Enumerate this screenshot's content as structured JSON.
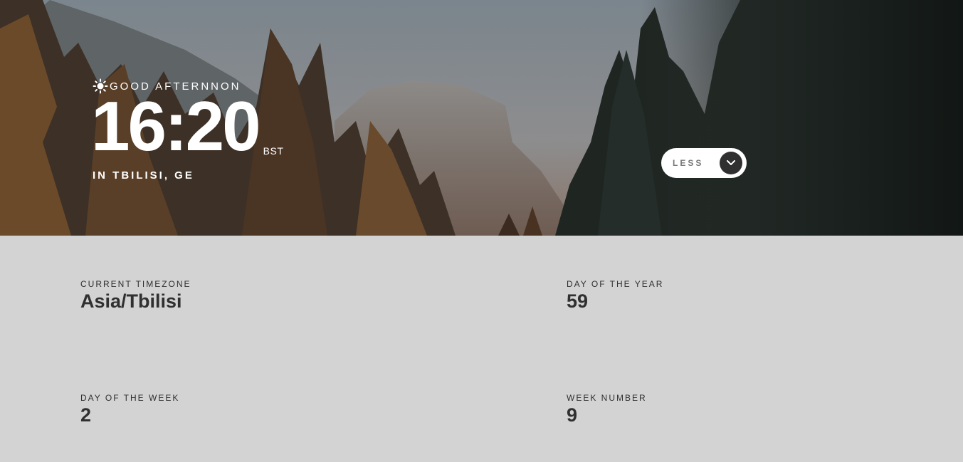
{
  "hero": {
    "greeting": "GOOD AFTERNNON",
    "greeting_icon": "sun-icon",
    "time": "16:20",
    "timezone_abbreviation": "BST",
    "location": "IN TBILISI, GE",
    "toggle_label": "LESS",
    "toggle_icon": "chevron-down-icon"
  },
  "details": {
    "current_timezone": {
      "label": "CURRENT TIMEZONE",
      "value": "Asia/Tbilisi"
    },
    "day_of_year": {
      "label": "DAY OF THE YEAR",
      "value": "59"
    },
    "day_of_week": {
      "label": "DAY OF THE WEEK",
      "value": "2"
    },
    "week_number": {
      "label": "WEEK NUMBER",
      "value": "9"
    }
  },
  "colors": {
    "details_background": "#d3d3d3",
    "text_dark": "#303030",
    "toggle_knob": "#303030",
    "white": "#ffffff"
  }
}
